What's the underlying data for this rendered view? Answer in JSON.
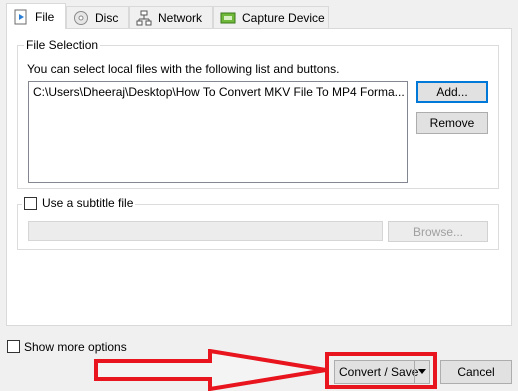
{
  "tabs": [
    {
      "label": "File",
      "icon": "play-file-icon",
      "active": true
    },
    {
      "label": "Disc",
      "icon": "disc-icon",
      "active": false
    },
    {
      "label": "Network",
      "icon": "network-icon",
      "active": false
    },
    {
      "label": "Capture Device",
      "icon": "capture-device-icon",
      "active": false
    }
  ],
  "file_selection": {
    "title": "File Selection",
    "description": "You can select local files with the following list and buttons.",
    "files": [
      "C:\\Users\\Dheeraj\\Desktop\\How To Convert MKV  File To MP4 Forma..."
    ],
    "add_label": "Add...",
    "remove_label": "Remove"
  },
  "subtitle": {
    "checkbox_label": "Use a subtitle file",
    "checked": false,
    "browse_label": "Browse..."
  },
  "footer": {
    "show_more_label": "Show more options",
    "show_more_checked": false,
    "convert_label": "Convert / Save",
    "cancel_label": "Cancel"
  },
  "colors": {
    "annotation_red": "#e8141e",
    "focus_blue": "#0078d7"
  }
}
